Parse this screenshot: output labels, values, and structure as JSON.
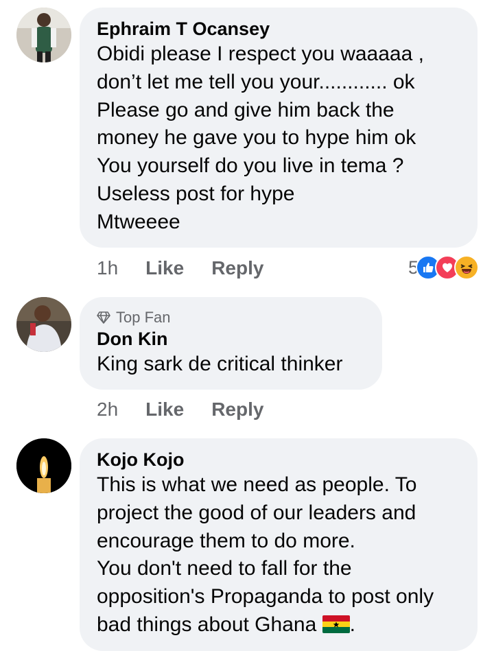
{
  "comments": [
    {
      "author": "Ephraim T Ocansey",
      "lines": [
        "Obidi please I respect you waaaaa ,",
        "don’t let me tell you your............ ok",
        "Please go and give him back the",
        "money he gave you to hype him ok",
        "You yourself do you live in tema ?",
        "Useless post for hype",
        "Mtweeee"
      ],
      "time": "1h",
      "like_label": "Like",
      "reply_label": "Reply",
      "reaction_count": "5",
      "reactions": [
        "like-icon",
        "love-icon",
        "haha-icon"
      ]
    },
    {
      "badge": "Top Fan",
      "author": "Don Kin",
      "lines": [
        "King sark de critical thinker"
      ],
      "time": "2h",
      "like_label": "Like",
      "reply_label": "Reply"
    },
    {
      "author": "Kojo Kojo",
      "lines": [
        "This is what we need as people. To",
        "project the good of our leaders and",
        "encourage them to do more.",
        "You don't need to fall for the",
        "opposition's Propaganda to post only",
        "bad things about Ghana"
      ],
      "trailing_emoji": "ghana-flag-icon",
      "trailing_punct": "."
    }
  ],
  "colors": {
    "bubble": "#f0f2f5",
    "meta_text": "#65676b",
    "like_blue": "#1877f2",
    "love_red": "#f33e58",
    "haha_yellow": "#f7b125"
  }
}
